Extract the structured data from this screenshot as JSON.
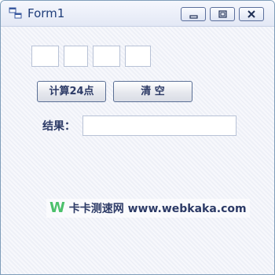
{
  "window": {
    "title": "Form1"
  },
  "controls": {
    "minimize": "minimize",
    "maximize": "maximize",
    "close": "close"
  },
  "inputs": {
    "numbers": [
      "",
      "",
      "",
      ""
    ],
    "result_value": ""
  },
  "buttons": {
    "calculate": "计算24点",
    "clear": "清 空"
  },
  "labels": {
    "result": "结果："
  },
  "watermark": {
    "logo": "W",
    "text": "卡卡测速网 www.webkaka.com"
  },
  "colors": {
    "accent": "#2c3a66",
    "logo_green": "#4cc06b",
    "border": "#7f9db9"
  }
}
